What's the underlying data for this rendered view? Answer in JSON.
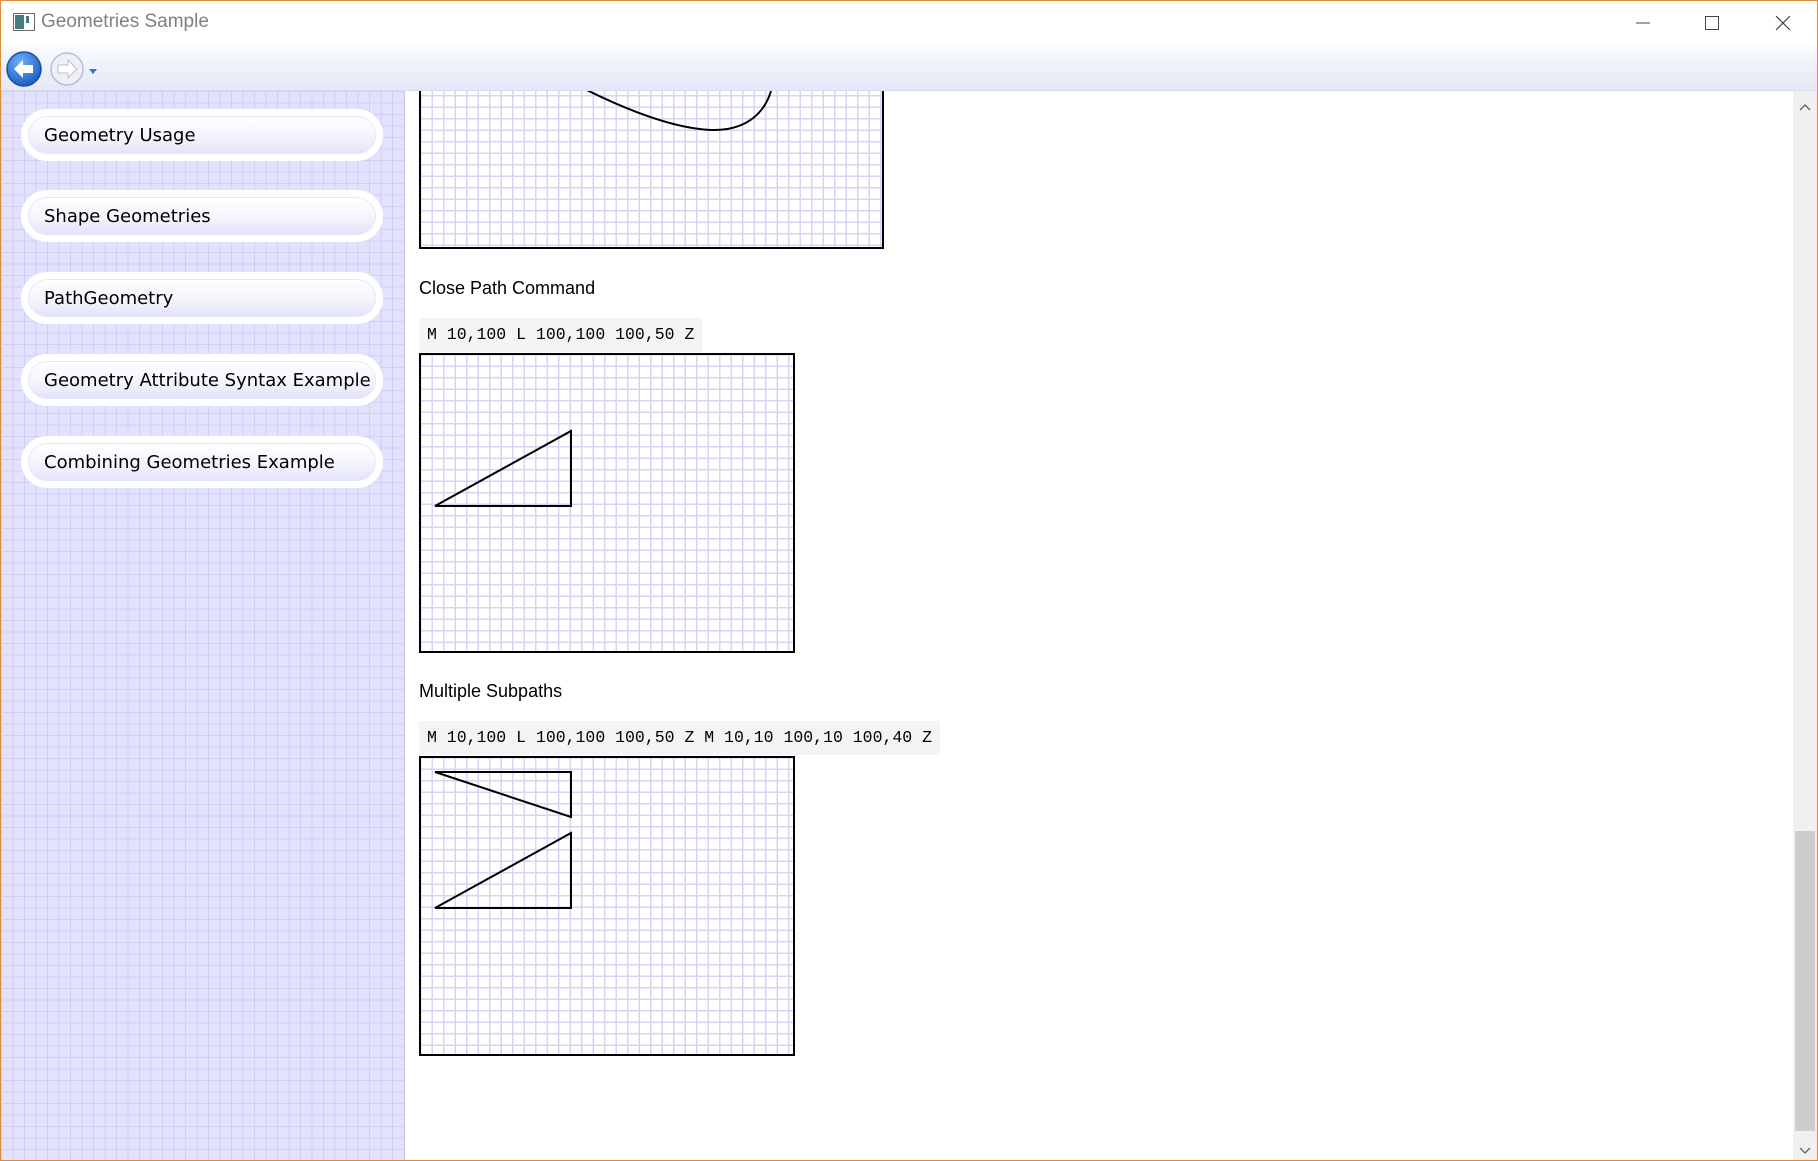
{
  "window": {
    "title": "Geometries Sample"
  },
  "nav": {
    "back_icon": "back-arrow-icon",
    "forward_icon": "forward-arrow-icon",
    "dropdown_icon": "chevron-down-icon"
  },
  "sidebar": {
    "items": [
      {
        "label": "Geometry Usage"
      },
      {
        "label": "Shape Geometries"
      },
      {
        "label": "PathGeometry"
      },
      {
        "label": "Geometry Attribute Syntax Example"
      },
      {
        "label": "Combining Geometries Example"
      }
    ]
  },
  "content": {
    "sections": [
      {
        "title": "Close Path Command",
        "code": "M 10,100 L 100,100 100,50 Z"
      },
      {
        "title": "Multiple Subpaths",
        "code": "M 10,100 L 100,100 100,50 Z M 10,10 100,10 100,40 Z"
      }
    ]
  },
  "colors": {
    "sidebar_bg": "#e2e2fe",
    "grid_line": "#d4d4f5",
    "window_border": "#e08a3a",
    "back_button": "#2a78d8"
  }
}
